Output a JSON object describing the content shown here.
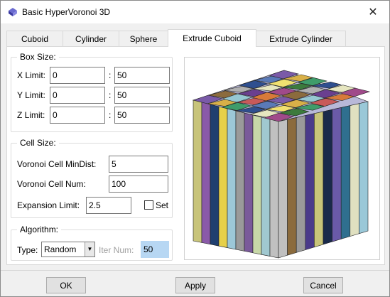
{
  "window": {
    "title": "Basic HyperVoronoi 3D",
    "close_glyph": "✕"
  },
  "tabs": [
    {
      "label": "Cuboid",
      "active": false
    },
    {
      "label": "Cylinder",
      "active": false
    },
    {
      "label": "Sphere",
      "active": false
    },
    {
      "label": "Extrude Cuboid",
      "active": true
    },
    {
      "label": "Extrude Cylinder",
      "active": false
    }
  ],
  "box_size": {
    "title": "Box Size:",
    "rows": [
      {
        "label": "X Limit:",
        "min": "0",
        "sep": ":",
        "max": "50"
      },
      {
        "label": "Y Limit:",
        "min": "0",
        "sep": ":",
        "max": "50"
      },
      {
        "label": "Z Limit:",
        "min": "0",
        "sep": ":",
        "max": "50"
      }
    ]
  },
  "cell_size": {
    "title": "Cell Size:",
    "min_dist_label": "Voronoi Cell MinDist:",
    "min_dist_value": "5",
    "num_label": "Voronoi Cell Num:",
    "num_value": "100",
    "expansion_label": "Expansion Limit:",
    "expansion_value": "2.5",
    "set_label": "Set",
    "set_checked": false
  },
  "algorithm": {
    "title": "Algorithm:",
    "type_label": "Type:",
    "type_value": "Random",
    "iter_label": "Iter Num:",
    "iter_value": "50"
  },
  "preview": {
    "icon": "voronoi-extruded-cube",
    "top_colors": [
      "#7a5aa8",
      "#d8b048",
      "#3f9c6a",
      "#2f4f8f",
      "#e6e6c0",
      "#a04a8a",
      "#8b6b3d",
      "#96c8d2",
      "#c85a5a",
      "#5a7ab8",
      "#f0e070",
      "#3c7a3c",
      "#b0b0b0",
      "#6a3f8f",
      "#d87a3a"
    ],
    "front_colors": [
      "#c8c47a",
      "#8a5aa8",
      "#1f3f6f",
      "#e6d04a",
      "#9cc8d8",
      "#9a9a9a",
      "#7a5a9a",
      "#c8d8a8",
      "#a0c8d0",
      "#c0c0c0"
    ],
    "right_colors": [
      "#c0c0c0",
      "#8b6b3d",
      "#9a9a9a",
      "#4a3a8a",
      "#c8c47a",
      "#1a2a4a",
      "#6a5aa8",
      "#2f6f8f",
      "#e0e0c0",
      "#9ac8d8"
    ]
  },
  "buttons": {
    "ok": "OK",
    "apply": "Apply",
    "cancel": "Cancel"
  }
}
